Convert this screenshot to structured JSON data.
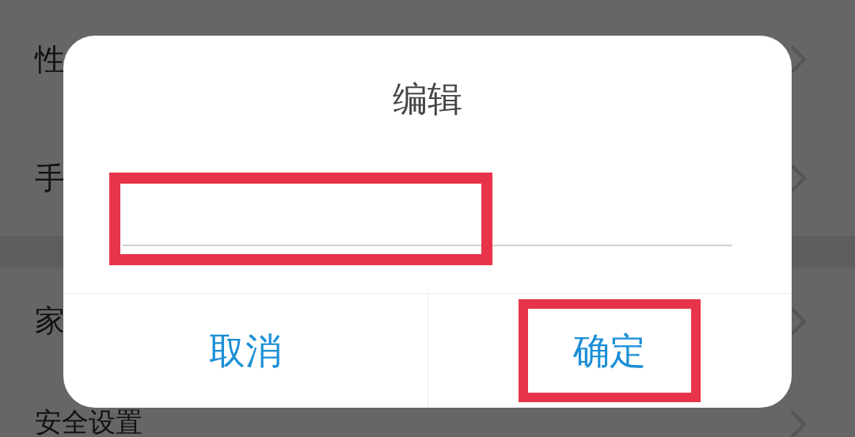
{
  "background_list": {
    "groups": [
      {
        "items": [
          {
            "label": "性"
          },
          {
            "label": "手"
          }
        ]
      },
      {
        "items": [
          {
            "label": "家"
          },
          {
            "label": "安全设置"
          }
        ]
      }
    ]
  },
  "dialog": {
    "title": "编辑",
    "buttons": [
      {
        "label": "取消",
        "highlighted": false
      },
      {
        "label": "确定",
        "highlighted": true
      }
    ]
  }
}
